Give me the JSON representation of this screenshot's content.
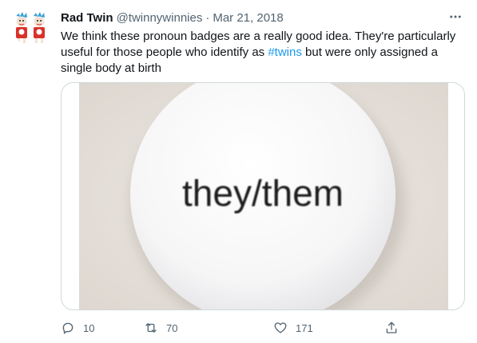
{
  "tweet": {
    "display_name": "Rad Twin",
    "handle": "@twinnywinnies",
    "separator": "·",
    "date": "Mar 21, 2018",
    "text_before": "We think these pronoun badges are a really good idea. They're particularly useful for those people who identify as ",
    "hashtag": "#twins",
    "text_after": " but were only assigned a single body at birth",
    "media": {
      "badge_text": "they/them"
    },
    "actions": {
      "replies": "10",
      "retweets": "70",
      "likes": "171"
    },
    "icons": {
      "more": "more-icon",
      "reply": "reply-icon",
      "retweet": "retweet-icon",
      "like": "heart-icon",
      "share": "share-icon"
    },
    "colors": {
      "text": "#0f1419",
      "secondary": "#536471",
      "link": "#1d9bf0",
      "border": "#cfd9de"
    }
  }
}
